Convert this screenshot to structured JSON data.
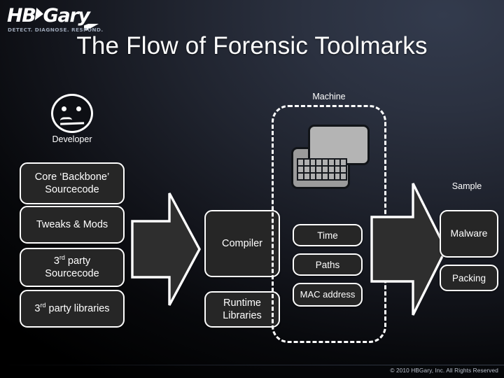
{
  "brand": {
    "wordmark_part1": "HB",
    "wordmark_part2": "Gary",
    "chevron_icon": "chevron-right-icon",
    "tagline": "DETECT.  DIAGNOSE.  RESPOND."
  },
  "slide": {
    "title": "The Flow of Forensic Toolmarks"
  },
  "developer": {
    "icon": "face-icon",
    "label": "Developer",
    "sources": [
      {
        "label_html": "Core ‘Backbone’<br>Sourcecode",
        "label": "Core ‘Backbone’ Sourcecode"
      },
      {
        "label_html": "Tweaks & Mods",
        "label": "Tweaks & Mods"
      },
      {
        "label_html": "3<sup>rd</sup> party<br>Sourcecode",
        "label": "3rd party Sourcecode"
      },
      {
        "label_html": "3<sup>rd</sup> party libraries",
        "label": "3rd party libraries"
      }
    ]
  },
  "arrows": [
    {
      "name": "arrow-developer-to-compiler",
      "direction": "right"
    },
    {
      "name": "arrow-machine-to-sample",
      "direction": "right"
    }
  ],
  "build": {
    "compiler_label": "Compiler",
    "runtime_label_html": "Runtime<br>Libraries",
    "runtime_label": "Runtime Libraries"
  },
  "machine": {
    "label": "Machine",
    "icon": "computer-keyboard-icon",
    "attributes": [
      {
        "label": "Time"
      },
      {
        "label": "Paths"
      },
      {
        "label": "MAC address"
      }
    ]
  },
  "sample": {
    "label": "Sample",
    "items": [
      {
        "label": "Malware"
      },
      {
        "label": "Packing"
      }
    ]
  },
  "footer": {
    "copyright": "© 2010 HBGary, Inc. All Rights Reserved"
  },
  "colors": {
    "background_top_right": "#2d3342",
    "background_bottom_left": "#000000",
    "box_fill": "#262626",
    "box_border": "#ffffff",
    "text": "#ffffff",
    "footer_text": "#b9c0cc"
  }
}
